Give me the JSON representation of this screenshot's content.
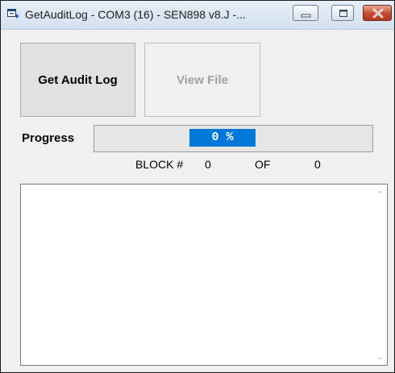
{
  "window": {
    "title": "GetAuditLog - COM3 (16) - SEN898 v8.J -...",
    "icon": "app-window-icon",
    "controls": {
      "minimize": "minimize-icon",
      "maximize": "maximize-icon",
      "close": "close-icon",
      "close_color": "#c4492d"
    }
  },
  "buttons": {
    "get_audit_log": "Get Audit Log",
    "view_file": "View File"
  },
  "progress": {
    "label": "Progress",
    "text": "0 %",
    "value_percent": 0,
    "highlight_color": "#0078d7"
  },
  "blocks": {
    "label": "BLOCK #",
    "current": "0",
    "of_label": "OF",
    "total": "0"
  },
  "log": {
    "content": "",
    "scroll_up": "scroll-up-icon",
    "scroll_down": "scroll-down-icon"
  }
}
